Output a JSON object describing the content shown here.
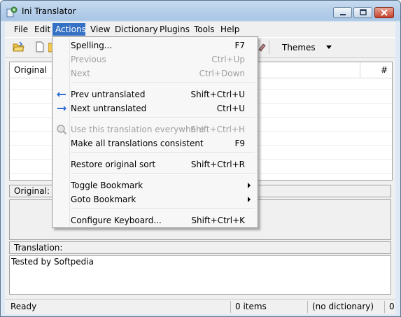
{
  "window": {
    "title": "Ini Translator"
  },
  "menubar": {
    "items": [
      {
        "label": "File"
      },
      {
        "label": "Edit"
      },
      {
        "label": "Actions"
      },
      {
        "label": "View"
      },
      {
        "label": "Dictionary"
      },
      {
        "label": "Plugins"
      },
      {
        "label": "Tools"
      },
      {
        "label": "Help"
      }
    ]
  },
  "toolbar": {
    "themes_label": "Themes"
  },
  "grid": {
    "col_original": "Original",
    "col_count": "#"
  },
  "original_section": {
    "label": "Original:"
  },
  "translation_section": {
    "label": "Translation:",
    "text": "Tested by Softpedia"
  },
  "status": {
    "state": "Ready",
    "items": "0 items",
    "dictionary": "(no dictionary)",
    "extra": "0"
  },
  "actions_menu": {
    "items": [
      {
        "label": "Spelling...",
        "shortcut": "F7",
        "enabled": true
      },
      {
        "label": "Previous",
        "shortcut": "Ctrl+Up",
        "enabled": false
      },
      {
        "label": "Next",
        "shortcut": "Ctrl+Down",
        "enabled": false
      },
      {
        "label": "Prev untranslated",
        "shortcut": "Shift+Ctrl+U",
        "enabled": true,
        "icon": "arrow-left-icon"
      },
      {
        "label": "Next untranslated",
        "shortcut": "Ctrl+U",
        "enabled": true,
        "icon": "arrow-right-icon"
      },
      {
        "label": "Use this translation everywhere",
        "shortcut": "Shift+Ctrl+H",
        "enabled": false,
        "icon": "magnifier-icon"
      },
      {
        "label": "Make all translations consistent",
        "shortcut": "F9",
        "enabled": true
      },
      {
        "label": "Restore original sort",
        "shortcut": "Shift+Ctrl+R",
        "enabled": true
      },
      {
        "label": "Toggle Bookmark",
        "shortcut": "",
        "enabled": true,
        "submenu": true
      },
      {
        "label": "Goto Bookmark",
        "shortcut": "",
        "enabled": true,
        "submenu": true
      },
      {
        "label": "Configure Keyboard...",
        "shortcut": "Shift+Ctrl+K",
        "enabled": true
      }
    ]
  },
  "colors": {
    "menu_highlight": "#3470c3",
    "arrow_blue": "#2f6fd6"
  }
}
